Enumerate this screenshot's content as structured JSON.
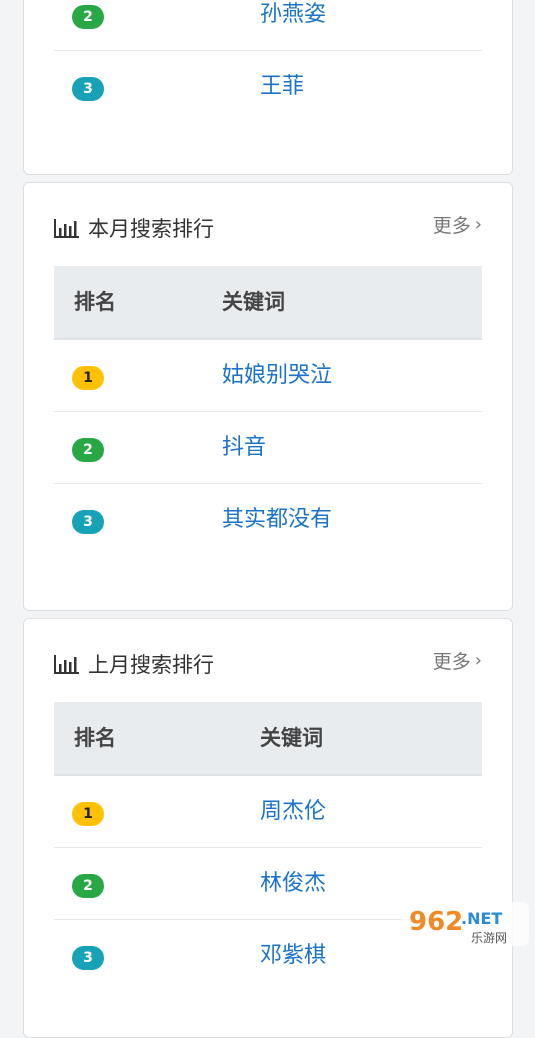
{
  "top_card": {
    "rows": [
      {
        "rank": "2",
        "keyword": "孙燕姿"
      },
      {
        "rank": "3",
        "keyword": "王菲"
      }
    ]
  },
  "month_card": {
    "title": "本月搜索排行",
    "more": "更多",
    "col_rank": "排名",
    "col_keyword": "关键词",
    "rows": [
      {
        "rank": "1",
        "keyword": "姑娘别哭泣"
      },
      {
        "rank": "2",
        "keyword": "抖音"
      },
      {
        "rank": "3",
        "keyword": "其实都没有"
      }
    ]
  },
  "lastmonth_card": {
    "title": "上月搜索排行",
    "more": "更多",
    "col_rank": "排名",
    "col_keyword": "关键词",
    "rows": [
      {
        "rank": "1",
        "keyword": "周杰伦"
      },
      {
        "rank": "2",
        "keyword": "林俊杰"
      },
      {
        "rank": "3",
        "keyword": "邓紫棋"
      }
    ]
  },
  "watermark": {
    "brand": "962",
    "suffix": ".NET",
    "caption": "乐游网"
  },
  "colors": {
    "link": "#1a73c9",
    "rank1": "#ffc107",
    "rank2": "#28a745",
    "rank3": "#17a2b8"
  }
}
